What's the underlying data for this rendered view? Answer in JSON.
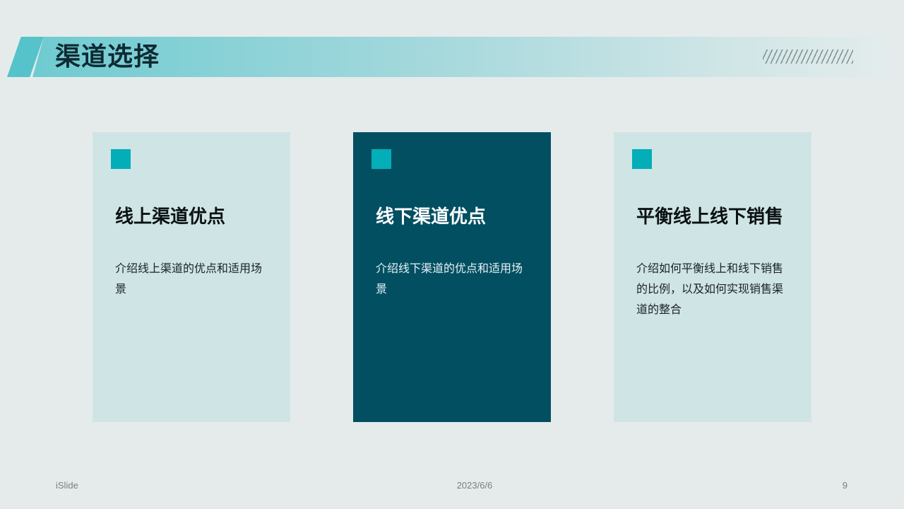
{
  "slide": {
    "title": "渠道选择",
    "cards": [
      {
        "title": "线上渠道优点",
        "description": "介绍线上渠道的优点和适用场景",
        "style": "light"
      },
      {
        "title": "线下渠道优点",
        "description": "介绍线下渠道的优点和适用场景",
        "style": "dark"
      },
      {
        "title": "平衡线上线下销售",
        "description": "介绍如何平衡线上和线下销售的比例，以及如何实现销售渠道的整合",
        "style": "light"
      }
    ]
  },
  "footer": {
    "brand": "iSlide",
    "date": "2023/6/6",
    "page_number": "9"
  },
  "colors": {
    "background": "#e5ebeb",
    "accent": "#03aeb8",
    "dark_card": "#024f62",
    "light_card": "#cfe4e5",
    "banner": "#55c3c9"
  }
}
